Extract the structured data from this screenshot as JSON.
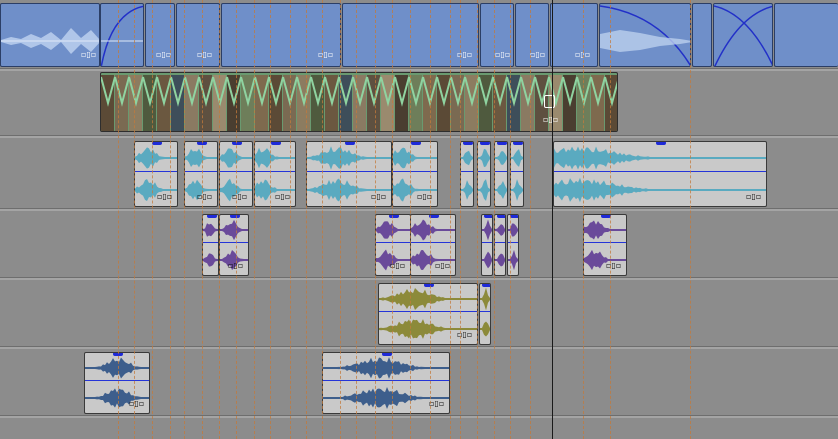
{
  "timeline": {
    "effect_glyph": "▫▯▫",
    "colors": {
      "background": "#8c8c8c",
      "top_clip": "#6f8fc9",
      "teal_wave": "#5aaac0",
      "purple_wave": "#6a4a9a",
      "olive_wave": "#8c8a3a",
      "navy_wave": "#3d5e8c",
      "volume_line": "#2535d8",
      "cue_line": "#c47a3a",
      "fade_curve": "#2230c8"
    }
  }
}
